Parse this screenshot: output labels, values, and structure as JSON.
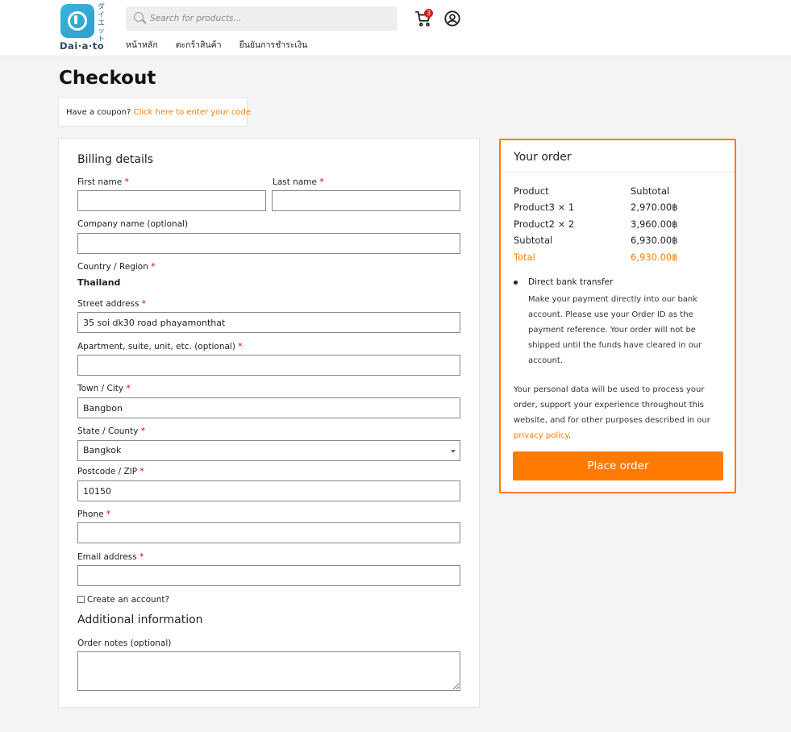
{
  "brand": {
    "logo_text": "Dai·a·to",
    "logo_vertical": "ダイエット",
    "colors": {
      "accent": "#ff7a00",
      "logo": "#3ab4d8",
      "badge": "#d42020"
    }
  },
  "header": {
    "search_placeholder": "Search for products...",
    "cart_count": "3",
    "nav": [
      "หน้าหลัก",
      "ตะกร้าสินค้า",
      "ยืนยันการชำระเงิน"
    ]
  },
  "page": {
    "title": "Checkout"
  },
  "coupon": {
    "prompt": "Have a coupon?",
    "link": "Click here to enter your code"
  },
  "billing": {
    "title": "Billing details",
    "first_name_label": "First name",
    "last_name_label": "Last name",
    "company_label": "Company name (optional)",
    "country_label": "Country / Region",
    "country_value": "Thailand",
    "street_label": "Street address",
    "street_value": "35 soi dk30 road phayamonthat",
    "apartment_label": "Apartment, suite, unit, etc. (optional)",
    "city_label": "Town / City",
    "city_value": "Bangbon",
    "state_label": "State / County",
    "state_value": "Bangkok",
    "postcode_label": "Postcode / ZIP",
    "postcode_value": "10150",
    "phone_label": "Phone",
    "email_label": "Email address",
    "create_account_label": "Create an account?",
    "required_mark": "*"
  },
  "additional": {
    "title": "Additional information",
    "notes_label": "Order notes (optional)"
  },
  "order": {
    "title": "Your order",
    "col_product": "Product",
    "col_subtotal": "Subtotal",
    "items": [
      {
        "name": "Product3  × 1",
        "amount": "2,970.00฿"
      },
      {
        "name": "Product2  × 2",
        "amount": "3,960.00฿"
      }
    ],
    "subtotal_label": "Subtotal",
    "subtotal_value": "6,930.00฿",
    "total_label": "Total",
    "total_value": "6,930.00฿",
    "payment_method": "Direct bank transfer",
    "payment_desc": "Make your payment directly into our bank account. Please use your Order ID as the payment reference. Your order will not be shipped until the funds have cleared in our account.",
    "privacy_text": "Your personal data will be used to process your order, support your experience throughout this website, and for other purposes described in our ",
    "privacy_link": "privacy policy",
    "privacy_end": ".",
    "place_order": "Place order"
  }
}
